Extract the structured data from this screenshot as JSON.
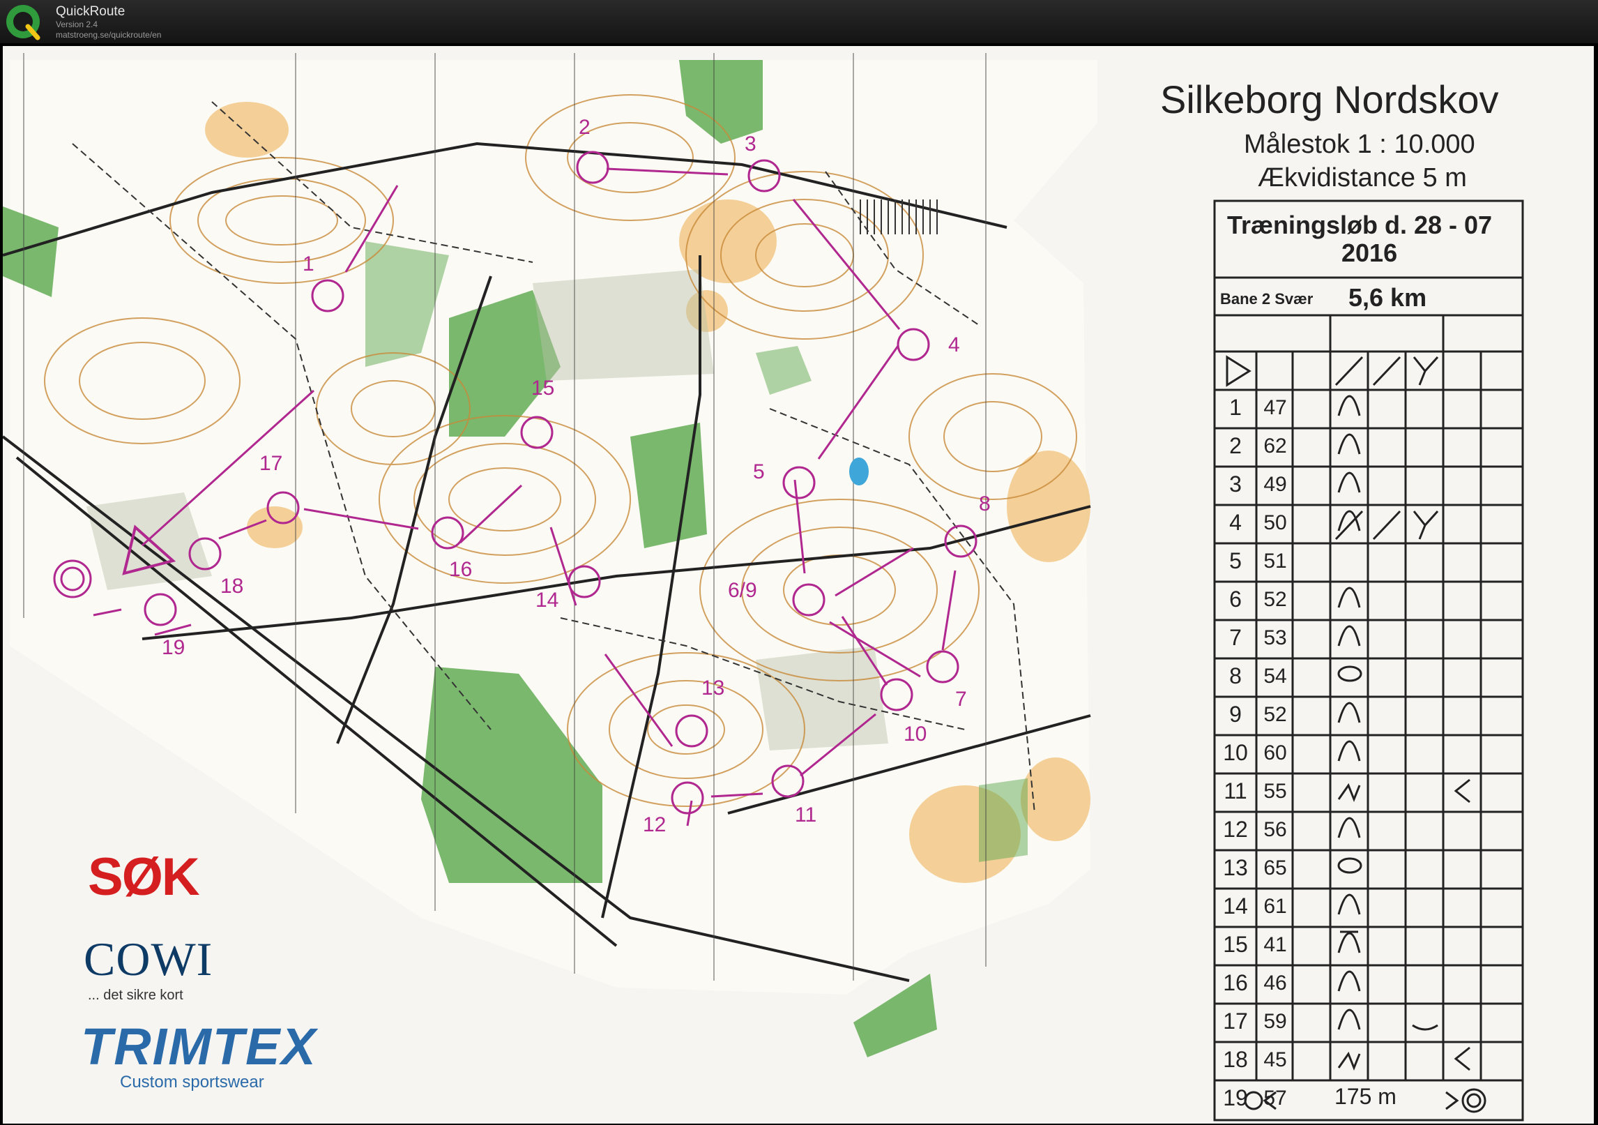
{
  "app": {
    "name": "QuickRoute",
    "version": "Version 2.4",
    "url": "matstroeng.se/quickroute/en"
  },
  "map": {
    "title": "Silkeborg Nordskov",
    "scale": "Målestok 1 : 10.000",
    "equidistance": "Ækvidistance 5 m"
  },
  "course_card": {
    "title_line1": "Træningsløb d. 28 - 07",
    "title_line2": "2016",
    "course": "Bane 2 Svær",
    "length": "5,6 km",
    "rows": [
      {
        "num": "1",
        "code": "47"
      },
      {
        "num": "2",
        "code": "62"
      },
      {
        "num": "3",
        "code": "49"
      },
      {
        "num": "4",
        "code": "50"
      },
      {
        "num": "5",
        "code": "51"
      },
      {
        "num": "6",
        "code": "52"
      },
      {
        "num": "7",
        "code": "53"
      },
      {
        "num": "8",
        "code": "54"
      },
      {
        "num": "9",
        "code": "52"
      },
      {
        "num": "10",
        "code": "60"
      },
      {
        "num": "11",
        "code": "55"
      },
      {
        "num": "12",
        "code": "56"
      },
      {
        "num": "13",
        "code": "65"
      },
      {
        "num": "14",
        "code": "61"
      },
      {
        "num": "15",
        "code": "41"
      },
      {
        "num": "16",
        "code": "46"
      },
      {
        "num": "17",
        "code": "59"
      },
      {
        "num": "18",
        "code": "45"
      },
      {
        "num": "19",
        "code": "57"
      }
    ],
    "finish_distance": "175 m"
  },
  "controls": [
    {
      "label": "1"
    },
    {
      "label": "2"
    },
    {
      "label": "3"
    },
    {
      "label": "4"
    },
    {
      "label": "5"
    },
    {
      "label": "6/9"
    },
    {
      "label": "7"
    },
    {
      "label": "8"
    },
    {
      "label": "10"
    },
    {
      "label": "11"
    },
    {
      "label": "12"
    },
    {
      "label": "13"
    },
    {
      "label": "14"
    },
    {
      "label": "15"
    },
    {
      "label": "16"
    },
    {
      "label": "17"
    },
    {
      "label": "18"
    },
    {
      "label": "19"
    }
  ],
  "sponsors": {
    "sok": "SØK",
    "cowi": "COWI",
    "cowi_tagline": "... det sikre kort",
    "trimtex": "TRIMTEX",
    "trimtex_tagline": "Custom sportswear"
  },
  "colors": {
    "course": "#b0278f",
    "forest": "#5aa84c",
    "open": "#f0b968",
    "contour": "#c98a3a"
  }
}
